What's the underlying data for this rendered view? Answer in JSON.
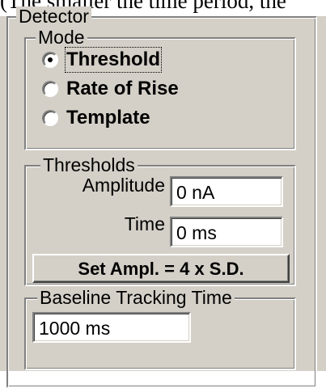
{
  "top_text": "(The smaller the time period, the",
  "detector": {
    "title": "Detector",
    "mode": {
      "title": "Mode",
      "options": [
        {
          "label": "Threshold",
          "checked": true
        },
        {
          "label": "Rate of Rise",
          "checked": false
        },
        {
          "label": "Template",
          "checked": false
        }
      ]
    },
    "thresholds": {
      "title": "Thresholds",
      "amplitude_label": "Amplitude",
      "amplitude_value": "0 nA",
      "time_label": "Time",
      "time_value": "0 ms",
      "set_button": "Set Ampl. = 4 x S.D."
    },
    "baseline": {
      "title": "Baseline Tracking Time",
      "value": "1000 ms"
    }
  }
}
